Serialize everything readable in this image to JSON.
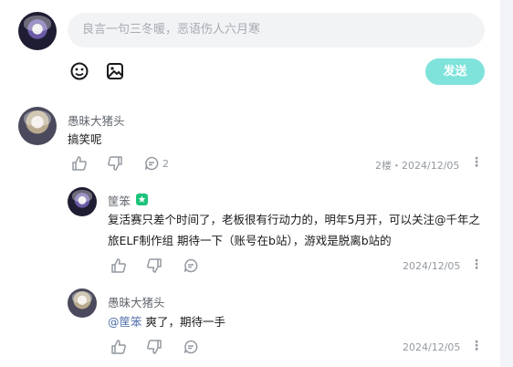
{
  "composer": {
    "placeholder": "良言一句三冬暖，恶语伤人六月寒",
    "send_label": "发送"
  },
  "comments": [
    {
      "user": "愚昧大猪头",
      "text": "搞笑呢",
      "reply_count": "2",
      "floor": "2楼",
      "date": "2024/12/05"
    }
  ],
  "replies": [
    {
      "user": "筐笨",
      "text_line1": "复活赛只差个时间了，老板很有行动力的，明年5月开，可以关注@千年之",
      "text_line2": "旅ELF制作组 期待一下（账号在b站），游戏是脱离b站的",
      "date": "2024/12/05"
    },
    {
      "user": "愚昧大猪头",
      "mention": "@筐笨",
      "text": " 爽了，期待一手",
      "date": "2024/12/05"
    }
  ],
  "separator": "・",
  "icons": [
    "emoji-icon",
    "image-icon",
    "thumb-up-icon",
    "thumb-down-icon",
    "comment-icon",
    "more-icon",
    "verified-badge-icon"
  ]
}
